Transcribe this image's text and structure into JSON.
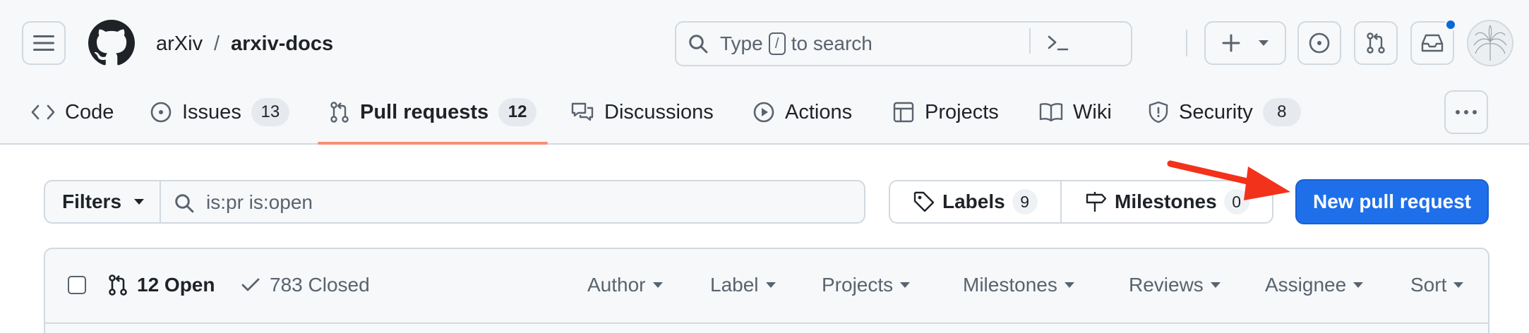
{
  "header": {
    "owner": "arXiv",
    "separator": "/",
    "repo": "arxiv-docs",
    "search": {
      "prefix": "Type",
      "key": "/",
      "suffix": "to search"
    },
    "notification_dot_color": "#0969da"
  },
  "tabs": [
    {
      "label": "Code",
      "icon": "code-icon"
    },
    {
      "label": "Issues",
      "icon": "issue-opened-icon",
      "count": "13"
    },
    {
      "label": "Pull requests",
      "icon": "git-pull-request-icon",
      "count": "12",
      "active": true
    },
    {
      "label": "Discussions",
      "icon": "comment-discussion-icon"
    },
    {
      "label": "Actions",
      "icon": "play-icon"
    },
    {
      "label": "Projects",
      "icon": "table-icon"
    },
    {
      "label": "Wiki",
      "icon": "book-icon"
    },
    {
      "label": "Security",
      "icon": "shield-icon",
      "count": "8"
    }
  ],
  "subnav": {
    "filters_label": "Filters",
    "filter_query": "is:pr is:open",
    "labels_label": "Labels",
    "labels_count": "9",
    "milestones_label": "Milestones",
    "milestones_count": "0",
    "new_pr_label": "New pull request",
    "new_pr_color": "#1f6feb",
    "annotation_arrow_color": "#f2321a"
  },
  "list_header": {
    "open_label": "12 Open",
    "closed_label": "783 Closed",
    "sort_options": [
      "Author",
      "Label",
      "Projects",
      "Milestones",
      "Reviews",
      "Assignee",
      "Sort"
    ]
  }
}
